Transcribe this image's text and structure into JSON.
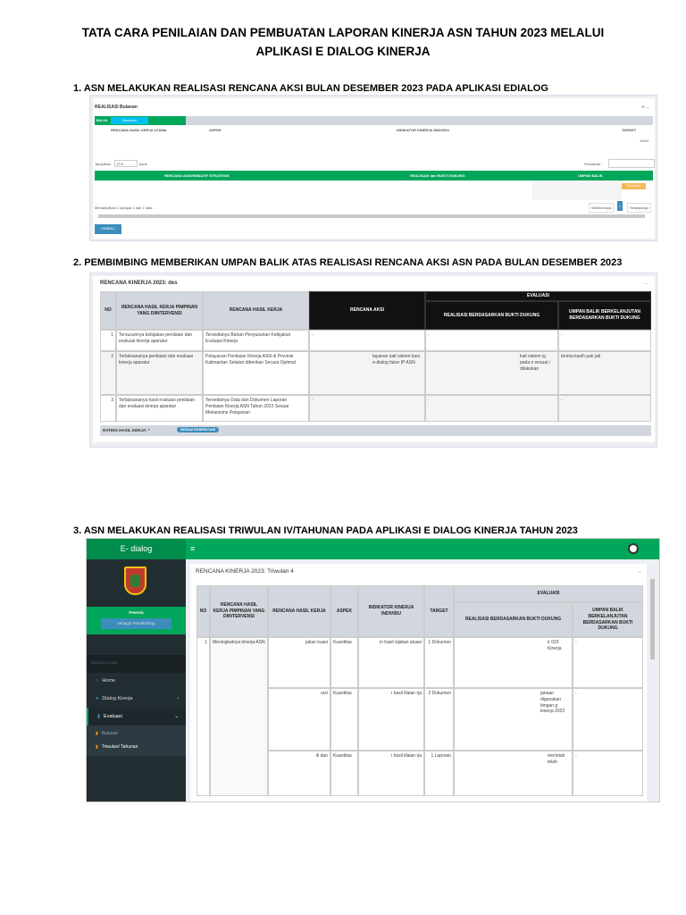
{
  "title_line1": "TATA CARA PENILAIAN DAN PEMBUATAN LAPORAN KINERJA ASN TAHUN 2023 MELALUI",
  "title_line2": "APLIKASI E DIALOG KINERJA",
  "steps": [
    "1.  ASN MELAKUKAN REALISASI RENCANA AKSI BULAN DESEMBER 2023 PADA APLIKASI EDIALOG",
    "2.  PEMBIMBING MEMBERIKAN UMPAN BALIK ATAS REALISASI RENCANA AKSI ASN PADA BULAN DESEMBER 2023",
    "3.  ASN MELAKUKAN REALISASI TRIWULAN IV/TAHUNAN PADA APLIKASI E DIALOG KINERJA TAHUN 2023"
  ],
  "shot1": {
    "title": "REALISASI Bulanan",
    "bulan_label": "BULAN",
    "bulan_value": "Desember",
    "cols": [
      "RENCANA HASIL KERJA UTAMA",
      "ASPEK",
      "INDIKATOR KINERJA INDIVIDU",
      "TARGET"
    ],
    "target": "100%",
    "show_label": "Tampilkan",
    "show_value": "10",
    "show_suffix": "baris",
    "search_label": "Pencarian :",
    "cols2": [
      "RENCANA AKSI/INISIATIF STRATEGIS",
      "REALISASI dan BUKTI DUKUNG",
      "UMPAN BALIK"
    ],
    "edit_btn": "Realisasi",
    "info": "Menampilkan 1 sampai 1 dari 1 data",
    "prev": "Sebelumnya",
    "page": "1",
    "next": "Selanjutnya",
    "back": "KEMBALI"
  },
  "shot2": {
    "title": "RENCANA KINERJA 2023: des",
    "cols": [
      "NO",
      "RENCANA HASIL KERJA PIMPINAN YANG DIINTERVENSI",
      "RENCANA HASIL KERJA",
      "RENCANA AKSI",
      "EVALUASI",
      "REALISASI BERDASARKAN BUKTI DUKUNG",
      "UMPAN BALIK BERKELANJUTAN BERDASARKAN BUKTI DUKUNG"
    ],
    "rows": [
      {
        "no": "1",
        "rhk_pimpinan": "Tersusunnya kebijakan penilaian dan evaluasi kinerja aparatur",
        "rhk": "Tersedianya Bahan Penyusunan Kebijakan Evaluasi Kinerja",
        "aksi": "-",
        "realisasi": "-",
        "umpan": "-"
      },
      {
        "no": "2",
        "rhk_pimpinan": "Terlaksananya penilaian dan evaluasi kinerja aparatur",
        "rhk": "Pelayanan Penilaian Kinerja ASN di Provinsi Kalimantan Selatan diberikan Secara Optimal",
        "aksi": "layanan kait sistem kasi e-dialog fakor IP ASN",
        "realisasi": "kait sistem ig pada n sesuai i dilakukan",
        "umpan": "terima kasih pak jati"
      },
      {
        "no": "3",
        "rhk_pimpinan": "Terlaksananya hasil evaluasi penilaian dan evaluasi kinerja aparatur",
        "rhk": "Tersedianya Data dan Dokumen Laporan Penilaian Kinerja ASN Tahun 2022 Sesuai Mekanisme Pelaporan",
        "aksi": "-",
        "realisasi": "-",
        "umpan": "-"
      }
    ],
    "rating_label": "RATING HASIL KERJA: *",
    "rating_value": "SESUAI EKSPEKTASI"
  },
  "shot3": {
    "brand": "E- dialog",
    "role": "Peserta",
    "switch": "sebagai Pembimbing",
    "nav_header": "NAVIGASI UTAMA",
    "menu": [
      "Home",
      "Dialog Kinerja",
      "Evaluasi",
      "Bulanan",
      "Triwulan/ Tahunan"
    ],
    "title": "RENCANA KINERJA 2023: Triwulan 4",
    "cols": [
      "NO",
      "RENCANA HASIL KERJA PIMPINAN YANG DIINTERVENSI",
      "RENCANA HASIL KERJA",
      "ASPEK",
      "INDIKATOR KINERJA INDIVIDU",
      "TARGET",
      "EVALUASI",
      "REALISASI BERDASARKAN BUKTI DUKUNG",
      "UMPAN BALIK BERKELANJUTAN BERDASARKAN BUKTI DUKUNG"
    ],
    "rows": [
      {
        "no": "1",
        "rhk_pimpinan": "Meningkatnya kinerja ASN",
        "rhk": "jakan kuasi",
        "aspek": "Kuantitas",
        "iki": "in hasil sijakan aluasi",
        "target": "1 Dokumen",
        "realisasi": "ir 023 Kinerja",
        "umpan": "-"
      },
      {
        "rhk": "ursi",
        "aspek": "Kuantitas",
        "iki": "i hasil illaian rja",
        "target": "2 Dokumen",
        "realisasi": "janaan digunakan bingan g kinerja 2022",
        "umpan": "-"
      },
      {
        "rhk": "ili dan",
        "aspek": "Kuantitas",
        "iki": "i hasil illaian rja",
        "target": "1 Laporan",
        "realisasi": "merintah telah",
        "umpan": "-"
      }
    ]
  },
  "colors": {
    "green": "#00a65a",
    "sidebar": "#222d32",
    "teal": "#00c0ef",
    "blue": "#3c8dbc",
    "orange": "#f39c12"
  }
}
